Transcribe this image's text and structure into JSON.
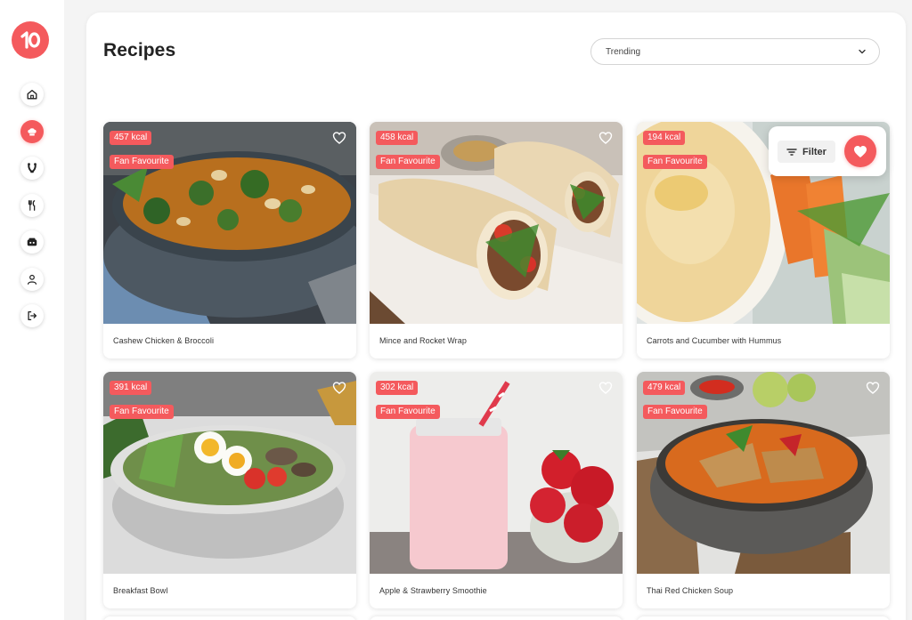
{
  "app": {
    "logo_text": "10",
    "brand_color": "#f45a5d"
  },
  "sidebar": {
    "items": [
      {
        "icon": "home-icon",
        "active": false
      },
      {
        "icon": "chef-hat-icon",
        "active": true
      },
      {
        "icon": "dumbbell-icon",
        "active": false
      },
      {
        "icon": "utensils-icon",
        "active": false
      },
      {
        "icon": "lunch-box-icon",
        "active": false
      },
      {
        "icon": "user-icon",
        "active": false
      },
      {
        "icon": "logout-icon",
        "active": false
      }
    ]
  },
  "header": {
    "title": "Recipes",
    "sort": {
      "selected": "Trending"
    }
  },
  "filter": {
    "label": "Filter",
    "favourite_icon": "heart-filled-icon"
  },
  "recipes": [
    {
      "name": "Cashew Chicken & Broccoli",
      "kcal": "457 kcal",
      "badge": "Fan Favourite"
    },
    {
      "name": "Mince and Rocket Wrap",
      "kcal": "458 kcal",
      "badge": "Fan Favourite"
    },
    {
      "name": "Carrots and Cucumber with Hummus",
      "kcal": "194 kcal",
      "badge": "Fan Favourite"
    },
    {
      "name": "Breakfast Bowl",
      "kcal": "391 kcal",
      "badge": "Fan Favourite"
    },
    {
      "name": "Apple & Strawberry Smoothie",
      "kcal": "302 kcal",
      "badge": "Fan Favourite"
    },
    {
      "name": "Thai Red Chicken Soup",
      "kcal": "479 kcal",
      "badge": "Fan Favourite"
    }
  ]
}
